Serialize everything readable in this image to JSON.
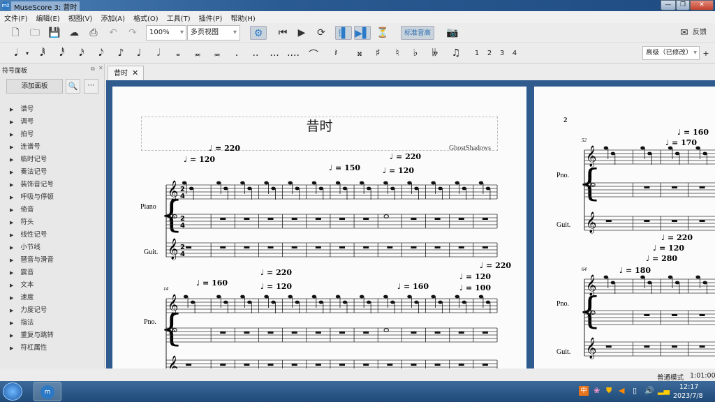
{
  "window": {
    "title": "MuseScore 3: 昔时",
    "app_icon": "m0"
  },
  "menu": [
    "文件(F)",
    "编辑(E)",
    "视图(V)",
    "添加(A)",
    "格式(O)",
    "工具(T)",
    "插件(P)",
    "帮助(H)"
  ],
  "toolbar": {
    "zoom": "100%",
    "view_mode": "多页视图",
    "concert_pitch": "标准音高",
    "feedback": "反馈"
  },
  "notebar": {
    "durations": [
      "𝅘𝅥𝅱",
      "𝅘𝅥𝅰",
      "𝅘𝅥𝅯",
      "𝅘𝅥𝅮",
      "♪",
      "♩",
      "𝅗𝅥",
      "𝅝",
      "𝅜",
      "𝅜"
    ],
    "accidentals": [
      "𝄪",
      "♯",
      "♮",
      "♭",
      "𝄫"
    ],
    "voices": [
      "1",
      "2",
      "3",
      "4"
    ],
    "workspace": "高级（已修改）",
    "add": "+"
  },
  "palette": {
    "title": "符号面板",
    "add_button": "添加面板",
    "items": [
      "谱号",
      "调号",
      "拍号",
      "连谱号",
      "临时记号",
      "奏法记号",
      "装饰音记号",
      "呼吸与停顿",
      "倚音",
      "符头",
      "线性记号",
      "小节线",
      "琶音与滑音",
      "震音",
      "文本",
      "速度",
      "力度记号",
      "指法",
      "重复与跳转",
      "符杠属性"
    ]
  },
  "tab": {
    "label": "昔时"
  },
  "score": {
    "title": "昔时",
    "composer": "GhostShadows",
    "page2_number": "2",
    "instruments": {
      "piano": "Piano",
      "pno": "Pno.",
      "guit": "Guit."
    },
    "measure_numbers": [
      "14",
      "52",
      "64"
    ],
    "tempos_p1": [
      "♩ = 220",
      "♩ = 120",
      "♩ = 150",
      "♩ = 220",
      "♩ = 120",
      "♩ = 160",
      "♩ = 220",
      "♩ = 120",
      "♩ = 160",
      "♩ = 220",
      "♩ = 120",
      "♩ = 100"
    ],
    "tempos_p2": [
      "♩ = 160",
      "♩ = 170",
      "♩ = 220",
      "♩ = 120",
      "♩ = 280",
      "♩ = 180"
    ]
  },
  "status": {
    "mode": "普通模式",
    "position": "1:01:000"
  },
  "taskbar": {
    "time": "12:17",
    "date": "2023/7/8",
    "ime": "中"
  }
}
